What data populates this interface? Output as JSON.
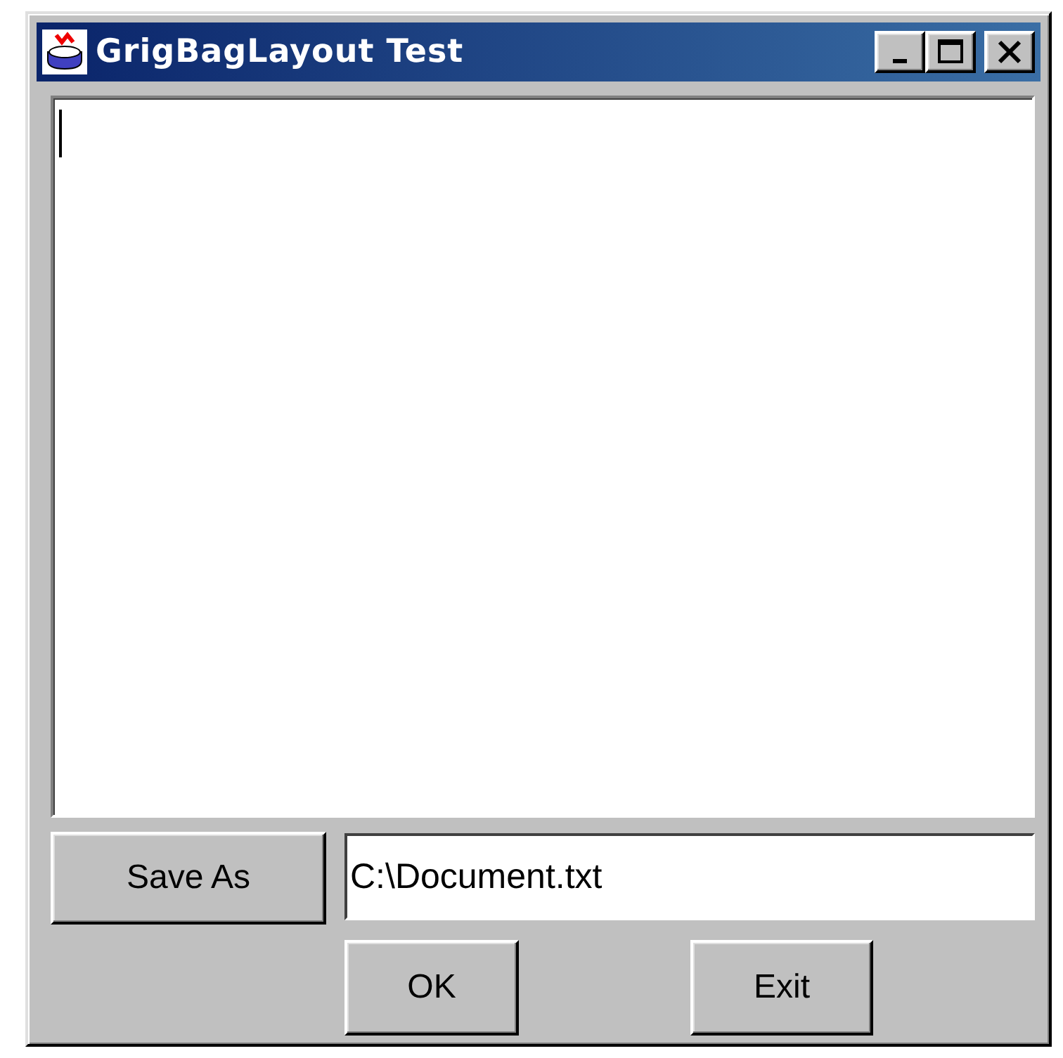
{
  "window": {
    "title": "GrigBagLayout Test"
  },
  "save_button": {
    "label": "Save As"
  },
  "file_field": {
    "value": "C:\\Document.txt"
  },
  "buttons": [
    {
      "label": "OK"
    },
    {
      "label": "Exit"
    }
  ]
}
